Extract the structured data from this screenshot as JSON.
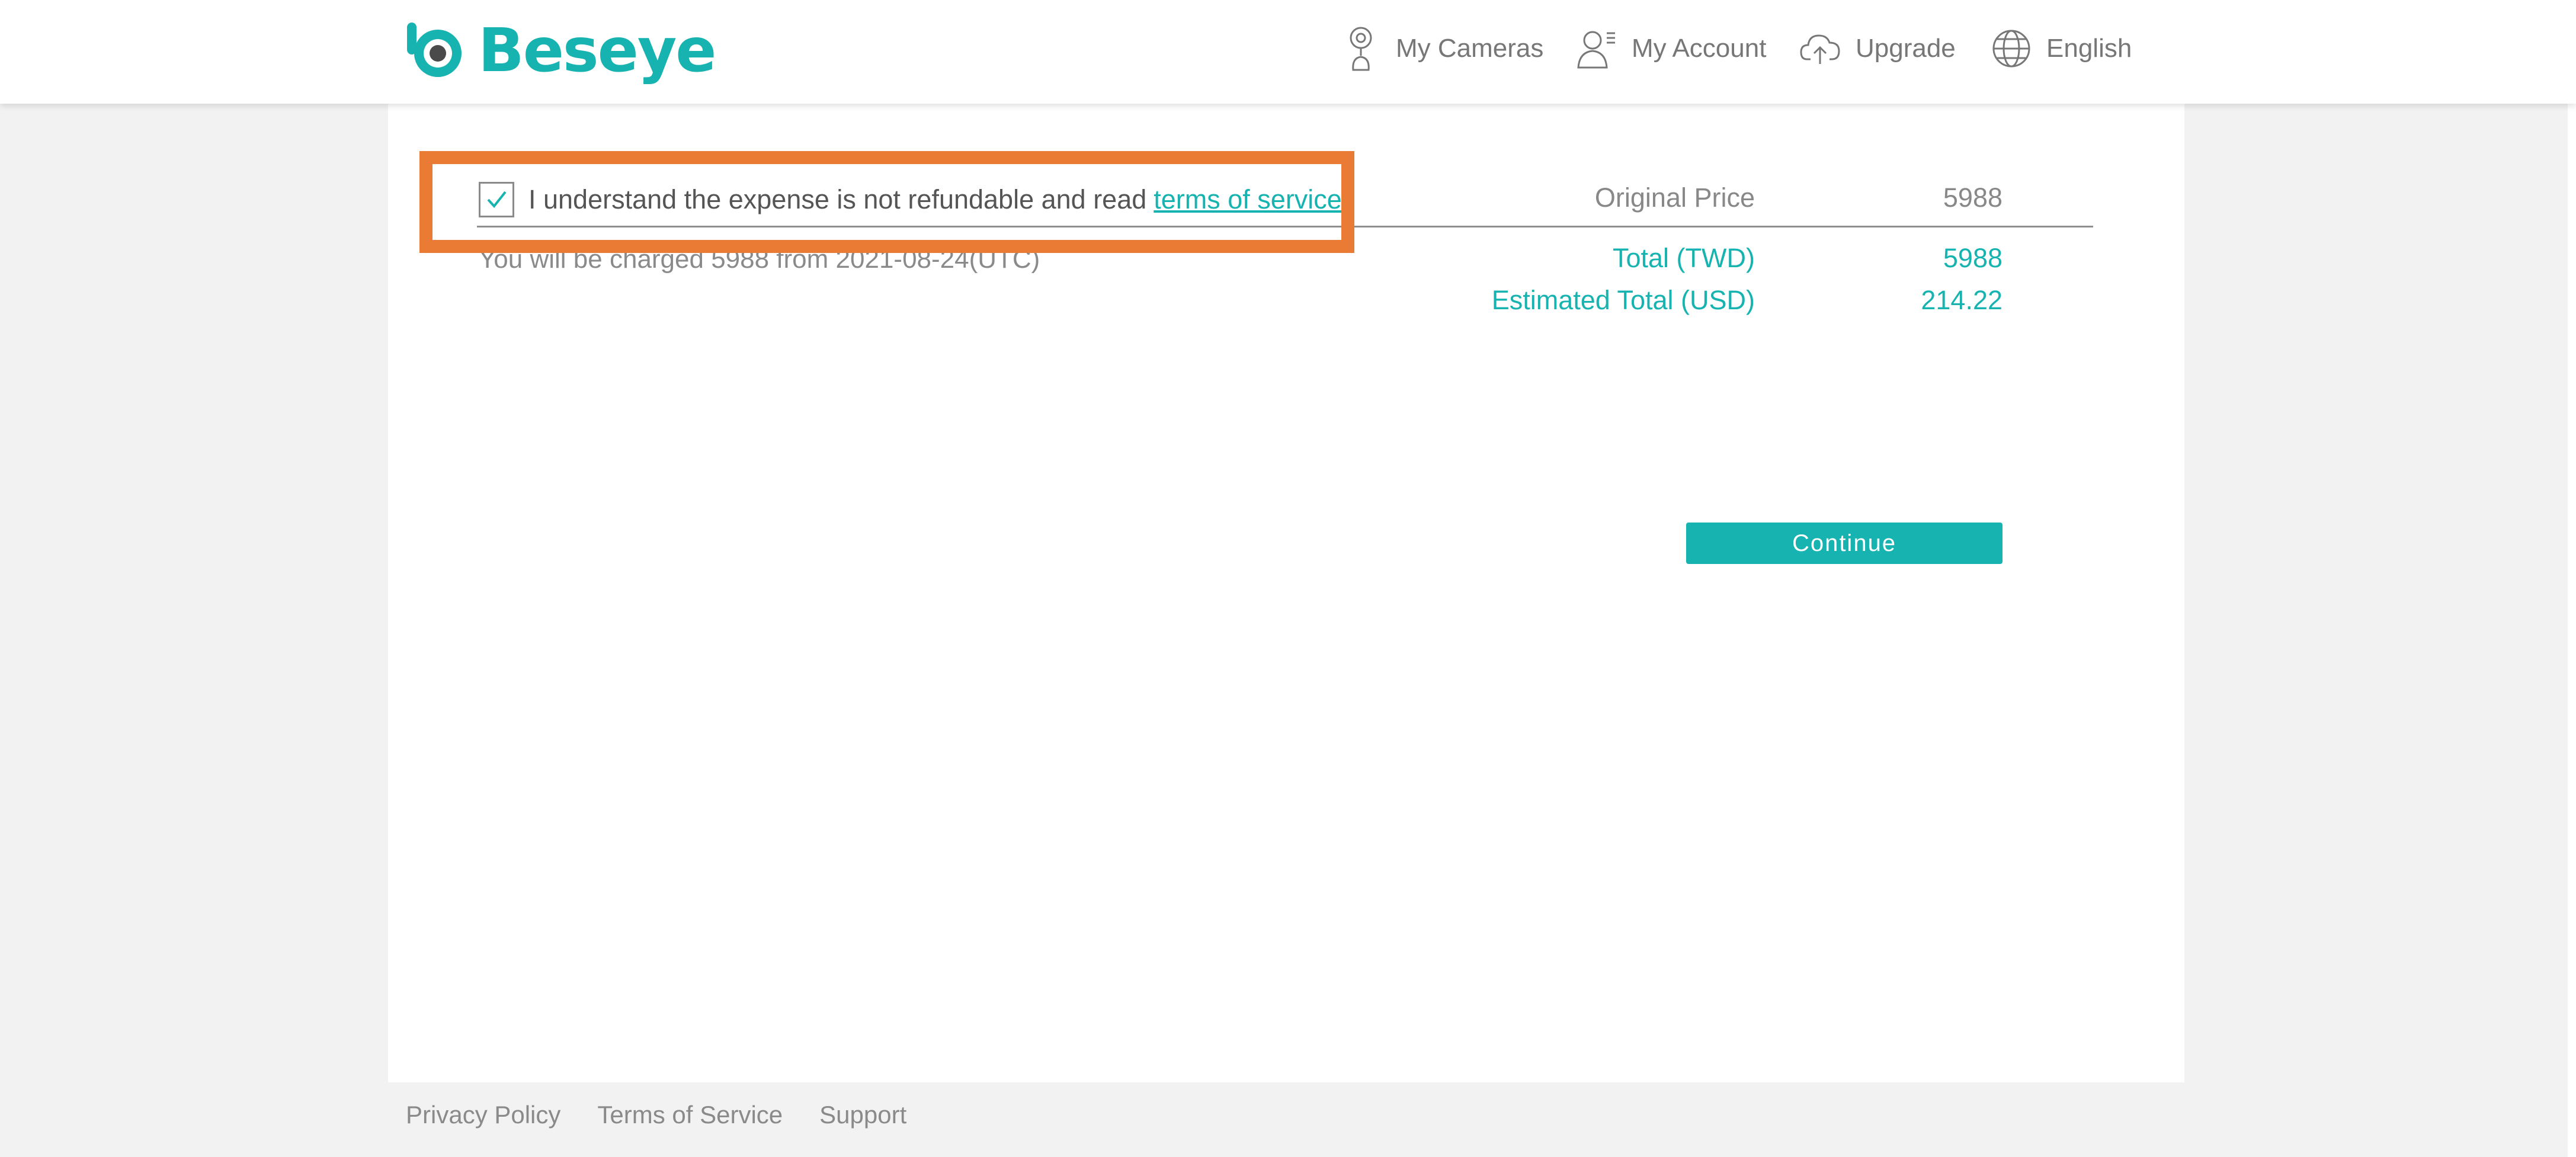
{
  "app": {
    "brand": "Beseye",
    "accent_color": "#16b3b0",
    "highlight_color": "#ea7b35"
  },
  "nav": {
    "items": [
      {
        "label": "My Cameras",
        "icon": "camera-icon"
      },
      {
        "label": "My Account",
        "icon": "account-icon"
      },
      {
        "label": "Upgrade",
        "icon": "cloud-upload-icon"
      },
      {
        "label": "English",
        "icon": "globe-icon"
      }
    ]
  },
  "agreement": {
    "checked": true,
    "text": "I understand the expense is not refundable and read ",
    "link": "terms of service",
    "suffix": "."
  },
  "charge_note": "You will be charged 5988 from 2021-08-24(UTC)",
  "prices": {
    "original_label": "Original Price",
    "original_value": "5988",
    "total_label": "Total (TWD)",
    "total_value": "5988",
    "estimated_label": "Estimated Total (USD)",
    "estimated_value": "214.22"
  },
  "continue_label": "Continue",
  "footer": {
    "links": [
      "Privacy Policy",
      "Terms of Service",
      "Support"
    ]
  }
}
